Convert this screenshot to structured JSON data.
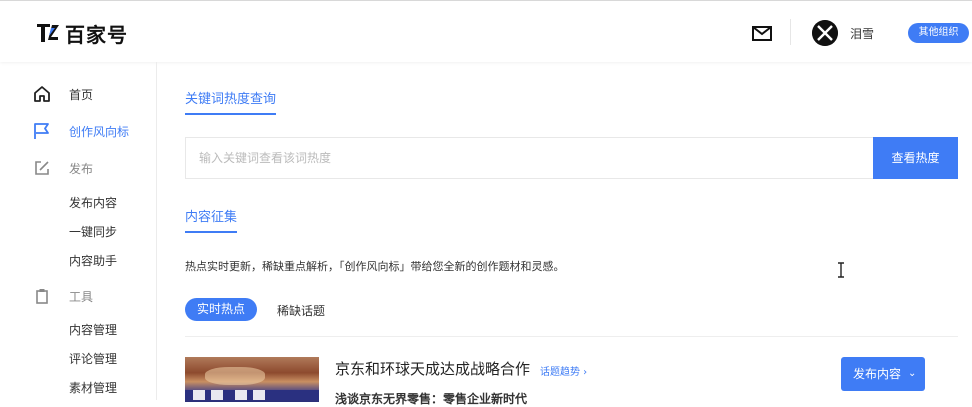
{
  "header": {
    "logo_text": "百家号",
    "username": "泪雪",
    "org_badge": "其他组织",
    "mail_icon": "mail-icon"
  },
  "sidebar": {
    "items": [
      {
        "label": "首页",
        "icon": "home-icon",
        "state": "normal"
      },
      {
        "label": "创作风向标",
        "icon": "flag-icon",
        "state": "active"
      },
      {
        "label": "发布",
        "icon": "edit-icon",
        "state": "muted"
      },
      {
        "label": "发布内容"
      },
      {
        "label": "一键同步"
      },
      {
        "label": "内容助手"
      },
      {
        "label": "工具",
        "icon": "clipboard-icon",
        "state": "muted"
      },
      {
        "label": "内容管理"
      },
      {
        "label": "评论管理"
      },
      {
        "label": "素材管理"
      }
    ]
  },
  "main": {
    "keyword_tab": "关键词热度查询",
    "search": {
      "placeholder": "输入关键词查看该词热度",
      "button": "查看热度"
    },
    "collection_tab": "内容征集",
    "description": "热点实时更新，稀缺重点解析，「创作风向标」带给您全新的创作题材和灵感。",
    "pills": [
      "实时热点",
      "稀缺话题"
    ],
    "news": {
      "title": "京东和环球天成达成战略合作",
      "trend_link": "话题趋势 ›",
      "subtitle": "浅谈京东无界零售：零售企业新时代",
      "publish_button": "发布内容",
      "publish_chevron": "⌄"
    }
  },
  "colors": {
    "accent": "#3f7cf5",
    "text": "#333333",
    "muted": "#888888"
  }
}
